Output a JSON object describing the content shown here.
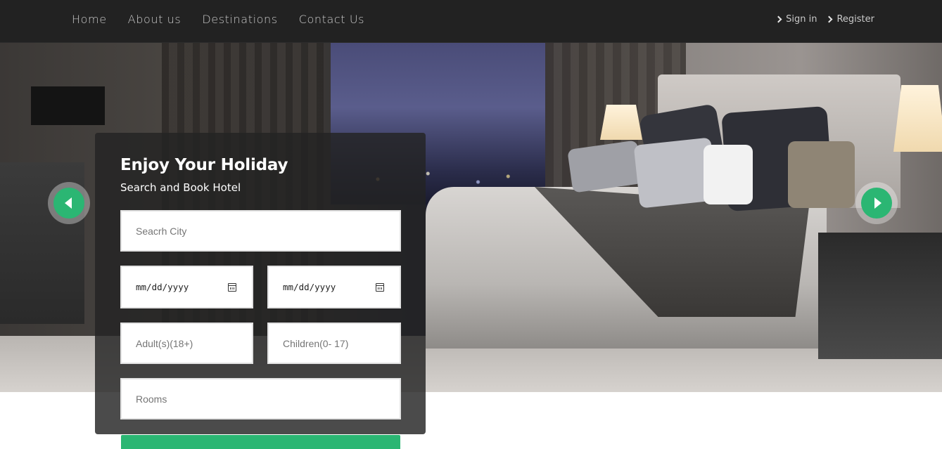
{
  "nav": {
    "links": [
      "Home",
      "About us",
      "Destinations",
      "Contact Us"
    ],
    "auth": [
      "Sign in",
      "Register"
    ]
  },
  "search": {
    "title": "Enjoy Your Holiday",
    "subtitle": "Search and Book Hotel",
    "city_placeholder": "Seacrh City",
    "checkin_value": "mm/dd/yyyy",
    "checkout_value": "mm/dd/yyyy",
    "adults_placeholder": "Adult(s)(18+)",
    "children_placeholder": "Children(0- 17)",
    "rooms_placeholder": "Rooms"
  },
  "colors": {
    "accent": "#2bb673",
    "navbar": "#222222",
    "panel": "rgba(35,35,35,0.82)"
  },
  "icons": {
    "prev": "caret-left-icon",
    "next": "caret-right-icon",
    "calendar": "calendar-icon",
    "chevron": "chevron-right-icon"
  }
}
